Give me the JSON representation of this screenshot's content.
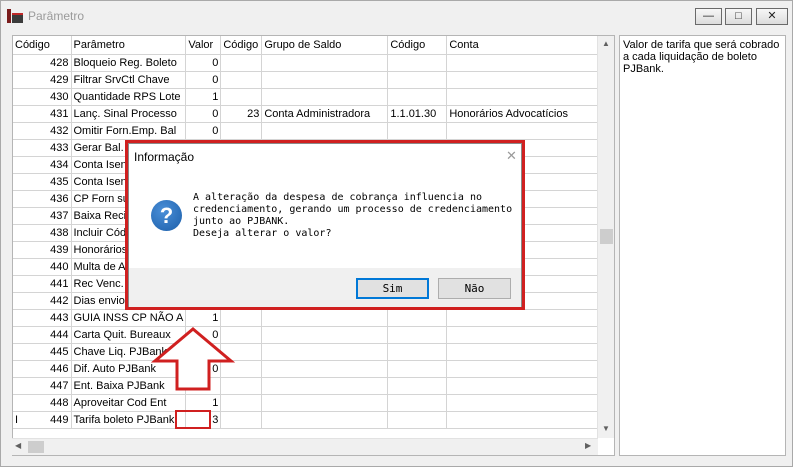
{
  "window": {
    "title": "Parâmetro",
    "min_label": "—",
    "max_label": "□",
    "close_label": "✕"
  },
  "grid": {
    "columns": [
      "Código",
      "Parâmetro",
      "Valor",
      "Código",
      "Grupo de Saldo",
      "Código",
      "Conta"
    ],
    "rows": [
      [
        "428",
        "Bloqueio Reg. Boleto",
        "0",
        "",
        "",
        "",
        ""
      ],
      [
        "429",
        "Filtrar SrvCtl Chave",
        "0",
        "",
        "",
        "",
        ""
      ],
      [
        "430",
        "Quantidade RPS Lote",
        "1",
        "",
        "",
        "",
        ""
      ],
      [
        "431",
        "Lanç. Sinal Processo",
        "0",
        "23",
        "Conta Administradora",
        "1.1.01.30",
        "Honorários Advocatícios"
      ],
      [
        "432",
        "Omitir Forn.Emp. Bal",
        "0",
        "",
        "",
        "",
        ""
      ],
      [
        "433",
        "Gerar Bal. s",
        "",
        "",
        "",
        "",
        ""
      ],
      [
        "434",
        "Conta Isenc",
        "",
        "",
        "",
        "",
        ""
      ],
      [
        "435",
        "Conta Isenc",
        "",
        "",
        "",
        "",
        ""
      ],
      [
        "436",
        "CP Forn sug",
        "",
        "",
        "",
        "",
        ""
      ],
      [
        "437",
        "Baixa Recib",
        "",
        "",
        "",
        "",
        ""
      ],
      [
        "438",
        "Incluir Códig",
        "",
        "",
        "",
        "",
        ""
      ],
      [
        "439",
        "Honorários",
        "",
        "",
        "",
        "",
        ""
      ],
      [
        "440",
        "Multa de Ar",
        "",
        "",
        "",
        "",
        ""
      ],
      [
        "441",
        "Rec Venc.",
        "",
        "",
        "",
        "",
        ""
      ],
      [
        "442",
        "Dias envio",
        "",
        "",
        "",
        "",
        ""
      ],
      [
        "443",
        "GUIA INSS CP NÃO A",
        "1",
        "",
        "",
        "",
        ""
      ],
      [
        "444",
        "Carta Quit. Bureaux",
        "0",
        "",
        "",
        "",
        ""
      ],
      [
        "445",
        "Chave Liq. PJBank",
        "",
        "",
        "",
        "",
        ""
      ],
      [
        "446",
        "Dif. Auto PJBank",
        "0",
        "",
        "",
        "",
        ""
      ],
      [
        "447",
        "Ent. Baixa PJBank",
        "",
        "",
        "",
        "",
        ""
      ],
      [
        "448",
        "Aproveitar Cod Ent",
        "1",
        "",
        "",
        "",
        ""
      ],
      [
        "449",
        "Tarifa boleto PJBank",
        "3",
        "",
        "",
        "",
        ""
      ]
    ],
    "row_indicator": "I"
  },
  "description": "Valor de tarifa que será cobrado a cada liquidação de boleto PJBank.",
  "dialog": {
    "title": "Informação",
    "close_label": "✕",
    "icon": "question-icon",
    "icon_glyph": "?",
    "message": "A alteração da despesa de cobrança influencia no\ncredenciamento, gerando um processo de credenciamento\njunto ao PJBANK.\nDeseja alterar o valor?",
    "yes_label": "Sim",
    "no_label": "Não"
  },
  "colors": {
    "highlight_red": "#d02020",
    "focus_blue": "#0078d7"
  }
}
